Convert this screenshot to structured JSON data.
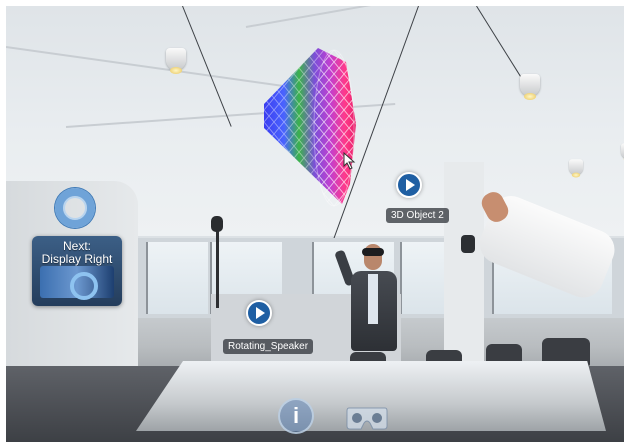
{
  "hologram_labels": {
    "next_display": "Next:\nDisplay Right",
    "object_3d": "3D Object 2",
    "rotating_speaker": "Rotating_Speaker"
  },
  "controls": {
    "info_glyph": "i"
  },
  "icons": {
    "play": "play-icon",
    "info": "info-icon",
    "vr_viewer": "vr-headset-icon",
    "ring": "ring-icon",
    "cursor": "pointer-cursor-icon"
  },
  "colors": {
    "play_button": "#1f5fa3",
    "ring": "#6fa3d8",
    "label_background": "#2c3035"
  }
}
